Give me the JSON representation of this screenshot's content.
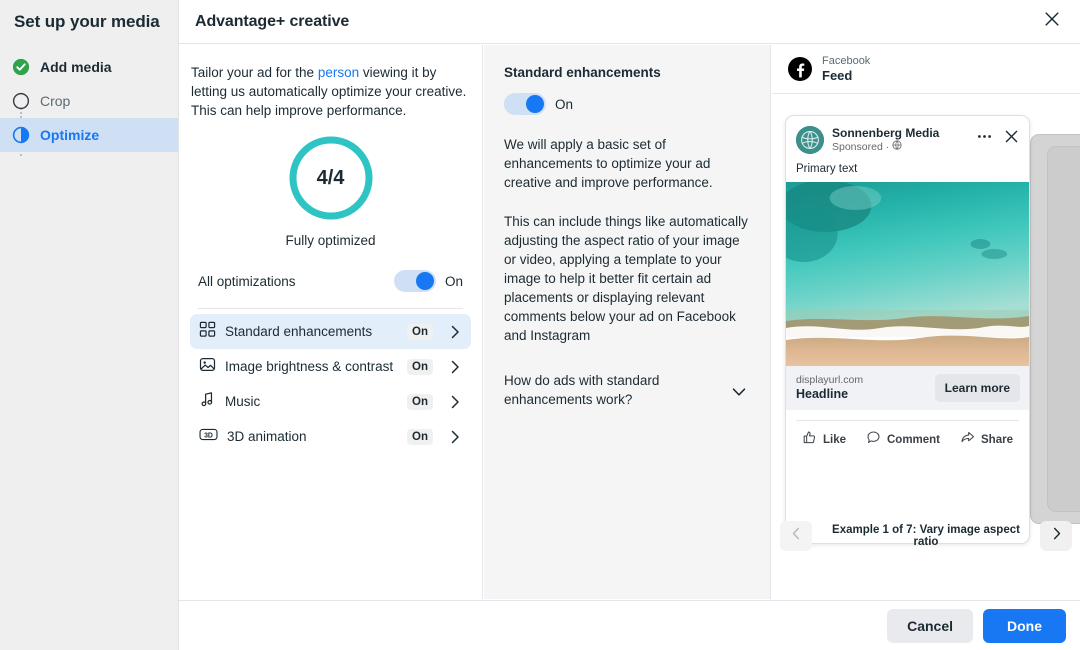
{
  "sidebar": {
    "title": "Set up your media",
    "steps": [
      {
        "label": "Add media",
        "state": "done",
        "icon": "check-circle-icon"
      },
      {
        "label": "Crop",
        "state": "todo",
        "icon": "empty-circle-icon"
      },
      {
        "label": "Optimize",
        "state": "active",
        "icon": "half-circle-icon"
      }
    ]
  },
  "header": {
    "title": "Advantage+ creative",
    "close_icon": "close-icon"
  },
  "optimize_panel": {
    "intro_before": "Tailor your ad for the ",
    "intro_link": "person",
    "intro_after": " viewing it by letting us automatically optimize your creative. This can help improve performance.",
    "score": "4/4",
    "score_caption": "Fully optimized",
    "ring_color": "#2ec4c4",
    "all_optimizations_label": "All optimizations",
    "all_optimizations_state": "On",
    "items": [
      {
        "label": "Standard enhancements",
        "state": "On",
        "icon": "grid-icon",
        "selected": true
      },
      {
        "label": "Image brightness & contrast",
        "state": "On",
        "icon": "image-icon",
        "selected": false
      },
      {
        "label": "Music",
        "state": "On",
        "icon": "music-note-icon",
        "selected": false
      },
      {
        "label": "3D animation",
        "state": "On",
        "icon": "threed-icon",
        "selected": false
      }
    ]
  },
  "detail_panel": {
    "title": "Standard enhancements",
    "toggle_state": "On",
    "paragraph_1": "We will apply a basic set of enhancements to optimize your ad creative and improve performance.",
    "paragraph_2": "This can include things like automatically adjusting the aspect ratio of your image or video, applying a template to your image to help it better fit certain ad placements or displaying relevant comments below your ad on Facebook and Instagram",
    "faq_question": "How do ads with standard enhancements work?",
    "faq_icon": "chevron-down-icon"
  },
  "preview": {
    "platform": "Facebook",
    "placement": "Feed",
    "platform_icon": "facebook-icon",
    "ad": {
      "page_name": "Sonnenberg Media",
      "sponsored": "Sponsored",
      "audience_icon": "globe-icon",
      "menu_icon": "ellipsis-icon",
      "close_icon": "close-icon",
      "primary_text": "Primary text",
      "display_url": "displayurl.com",
      "headline": "Headline",
      "cta": "Learn more",
      "footer_actions": [
        {
          "label": "Like",
          "icon": "thumbs-up-icon"
        },
        {
          "label": "Comment",
          "icon": "comment-icon"
        },
        {
          "label": "Share",
          "icon": "share-icon"
        }
      ]
    },
    "nav": {
      "prev_icon": "chevron-left-icon",
      "next_icon": "chevron-right-icon",
      "caption": "Example 1 of 7: Vary image aspect ratio"
    }
  },
  "footer": {
    "cancel_label": "Cancel",
    "done_label": "Done",
    "done_color": "#1877f2"
  }
}
